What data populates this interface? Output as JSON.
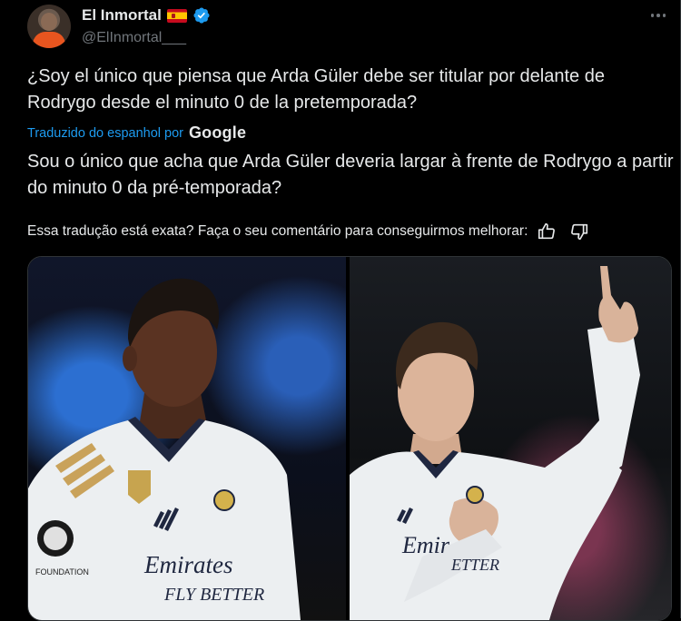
{
  "author": {
    "display_name": "El Inmortal",
    "handle": "@ElInmortal___",
    "flag_icon": "spain-flag-icon",
    "verified_icon": "verified-badge-icon",
    "verified_color": "#1d9bf0"
  },
  "tweet": {
    "original_text": "¿Soy el único que piensa que Arda Güler debe ser titular por delante de Rodrygo desde el minuto 0 de la pretemporada?",
    "translated_by_label": "Traduzido do espanhol por",
    "translator_brand": "Google",
    "translated_text": "Sou o único que acha que Arda Güler deveria largar à frente de Rodrygo a partir do minuto 0 da pré-temporada?",
    "feedback_question": "Essa tradução está exata? Faça o seu comentário para conseguirmos melhorar:"
  },
  "media": {
    "left_photo": {
      "chest_sponsor": "Emirates",
      "chest_sponsor_sub": "FLY BETTER",
      "sleeve_patch": "FOUNDATION"
    },
    "right_photo": {
      "chest_sponsor": "Emir",
      "chest_sponsor_sub": "ETTER"
    }
  },
  "colors": {
    "background": "#000000",
    "text": "#e7e9ea",
    "secondary_text": "#71767b",
    "link": "#1d9bf0"
  }
}
